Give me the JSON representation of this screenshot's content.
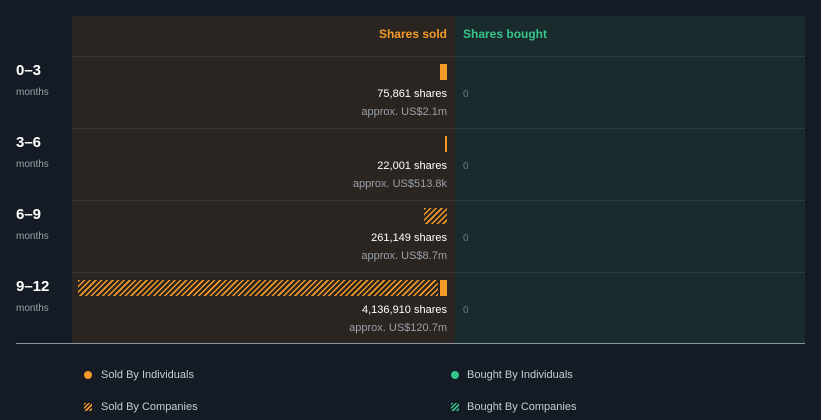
{
  "chart_data": {
    "type": "bar",
    "orientation": "horizontal",
    "columns": {
      "sold": "Shares sold",
      "bought": "Shares bought"
    },
    "periods": [
      {
        "label": "0–3",
        "unit": "months",
        "sold_individuals": 75861,
        "sold_companies": 0,
        "shares_text": "75,861 shares",
        "usd_text": "approx. US$2.1m",
        "bought": "0"
      },
      {
        "label": "3–6",
        "unit": "months",
        "sold_individuals": 22001,
        "sold_companies": 0,
        "shares_text": "22,001 shares",
        "usd_text": "approx. US$513.8k",
        "bought": "0"
      },
      {
        "label": "6–9",
        "unit": "months",
        "sold_individuals": 0,
        "sold_companies": 261149,
        "shares_text": "261,149 shares",
        "usd_text": "approx. US$8.7m",
        "bought": "0"
      },
      {
        "label": "9–12",
        "unit": "months",
        "sold_individuals": 75000,
        "sold_companies": 4061910,
        "shares_text": "4,136,910 shares",
        "usd_text": "approx. US$120.7m",
        "bought": "0"
      }
    ],
    "legend": [
      {
        "label": "Sold By Individuals",
        "marker": "dot",
        "color": "#f39a28"
      },
      {
        "label": "Bought By Individuals",
        "marker": "dot",
        "color": "#35c48a"
      },
      {
        "label": "Sold By Companies",
        "marker": "hatch",
        "color": "#f39a28"
      },
      {
        "label": "Bought By Companies",
        "marker": "hatch",
        "color": "#35c48a"
      }
    ],
    "colors": {
      "sold": "#f39a28",
      "bought": "#35c48a"
    }
  }
}
